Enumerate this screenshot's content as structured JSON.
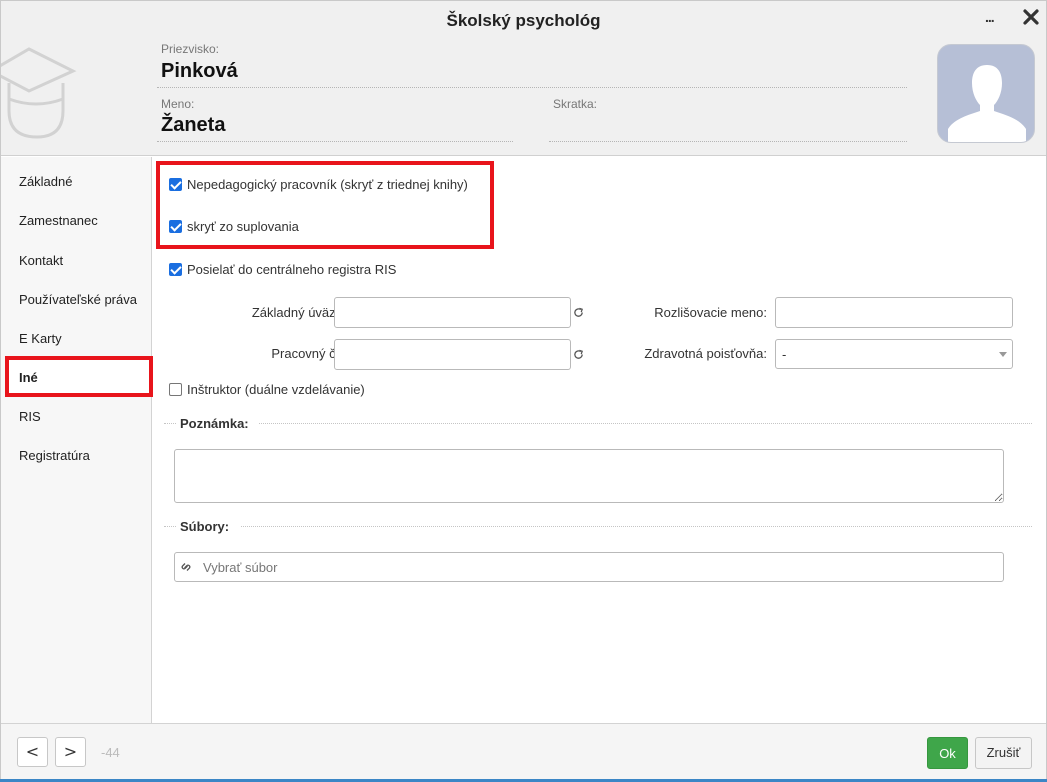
{
  "dialog": {
    "title": "Školský psychológ",
    "more_label": "...",
    "close_icon": "close-icon"
  },
  "header": {
    "surname_label": "Priezvisko:",
    "surname_value": "Pinková",
    "firstname_label": "Meno:",
    "firstname_value": "Žaneta",
    "abbreviation_label": "Skratka:",
    "abbreviation_value": "",
    "logo_icon": "teacher-cap-icon",
    "avatar_icon": "person-silhouette-icon"
  },
  "sidebar": {
    "items": [
      {
        "label": "Základné"
      },
      {
        "label": "Zamestnanec"
      },
      {
        "label": "Kontakt"
      },
      {
        "label": "Používateľské práva"
      },
      {
        "label": "E Karty"
      },
      {
        "label": "Iné"
      },
      {
        "label": "RIS"
      },
      {
        "label": "Registratúra"
      }
    ],
    "active_index": 5,
    "highlight_color": "#e8141b"
  },
  "form": {
    "non_pedagogical_label": "Nepedagogický pracovník (skryť z triednej knihy)",
    "non_pedagogical_checked": true,
    "hide_substitution_label": "skryť zo suplovania",
    "hide_substitution_checked": true,
    "send_ris_label": "Posielať do centrálneho registra RIS",
    "send_ris_checked": true,
    "base_workload_label": "Základný úväzok:",
    "base_workload_value": "",
    "working_time_label": "Pracovný čas:",
    "working_time_value": "",
    "distinguishing_name_label": "Rozlišovacie meno:",
    "distinguishing_name_value": "",
    "health_insurance_label": "Zdravotná poisťovňa:",
    "health_insurance_value": "-",
    "instructor_label": "Inštruktor (duálne vzdelávanie)",
    "instructor_checked": false,
    "note_section": "Poznámka:",
    "note_value": "",
    "files_section": "Súbory:",
    "file_placeholder": "Vybrať súbor",
    "highlight_color": "#e8141b",
    "checkbox_color": "#1a6ee0"
  },
  "footer": {
    "prev_label": "<",
    "next_label": ">",
    "record_id": "-44",
    "ok_label": "Ok",
    "cancel_label": "Zrušiť",
    "ok_color": "#3fa64a"
  }
}
